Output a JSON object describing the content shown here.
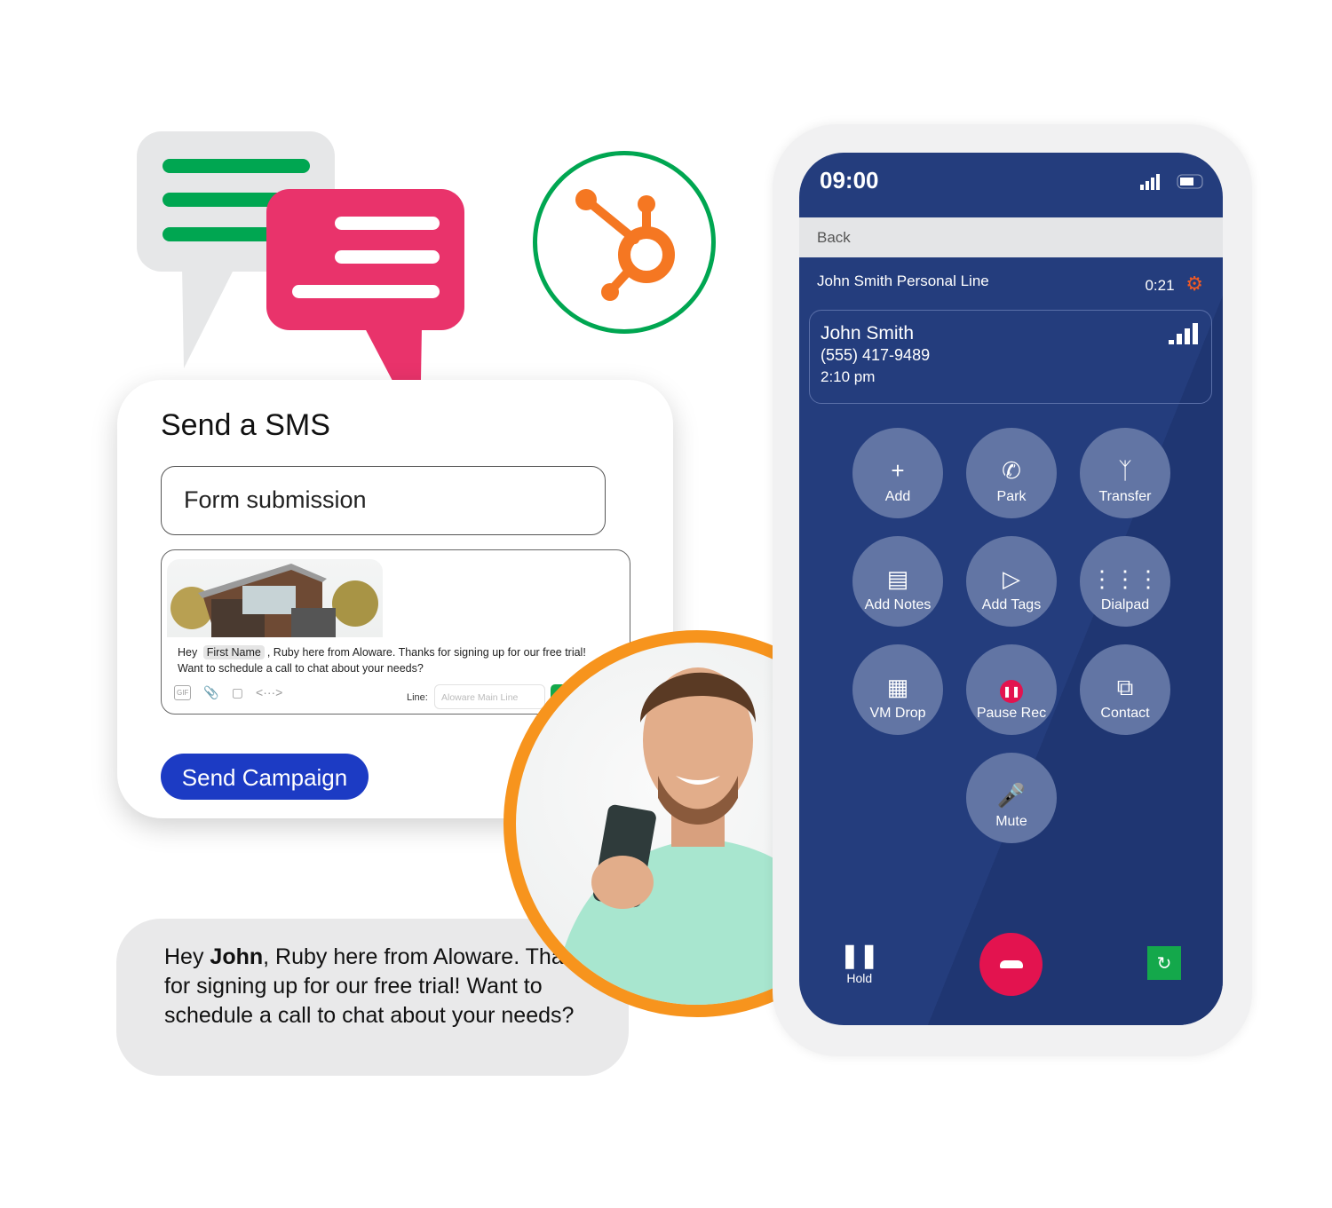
{
  "colors": {
    "green": "#00a651",
    "pink": "#e9336b",
    "orange": "#f7941d",
    "phone_blue": "#243d7d",
    "button_blue": "#1c3bc4",
    "end_call_red": "#e3134f",
    "gear_orange": "#f15a24"
  },
  "sms": {
    "title": "Send a SMS",
    "subject": "Form submission",
    "message_before": "Hey",
    "merge_field": "First Name",
    "message_after": ", Ruby here from Aloware. Thanks for signing up for our free trial! Want to schedule a call to chat about your needs?",
    "tool_icons": [
      "gif-icon",
      "paperclip-icon",
      "clipboard-icon",
      "code-icon"
    ],
    "line_label": "Line:",
    "line_placeholder": "Aloware Main Line",
    "send_label": "Send Campaign"
  },
  "chat": {
    "greeting": "Hey",
    "name": "John",
    "rest": ", Ruby here from Aloware. Thanks for signing up for our free trial! Want to schedule a call to chat about your needs?"
  },
  "phone": {
    "time": "09:00",
    "back": "Back",
    "line_name": "John Smith Personal Line",
    "duration": "0:21",
    "contact": {
      "name": "John Smith",
      "phone": "(555) 417-9489",
      "time": "2:10 pm"
    },
    "buttons": [
      {
        "label": "Add",
        "icon": "plus-icon"
      },
      {
        "label": "Park",
        "icon": "phone-park-icon"
      },
      {
        "label": "Transfer",
        "icon": "transfer-icon"
      },
      {
        "label": "Add Notes",
        "icon": "note-add-icon"
      },
      {
        "label": "Add Tags",
        "icon": "tag-icon"
      },
      {
        "label": "Dialpad",
        "icon": "dialpad-icon"
      },
      {
        "label": "VM Drop",
        "icon": "voicemail-icon"
      },
      {
        "label": "Pause Rec",
        "icon": "pause-record-icon"
      },
      {
        "label": "Contact",
        "icon": "external-link-icon"
      },
      {
        "label": "Mute",
        "icon": "microphone-icon"
      }
    ],
    "hold": "Hold"
  }
}
